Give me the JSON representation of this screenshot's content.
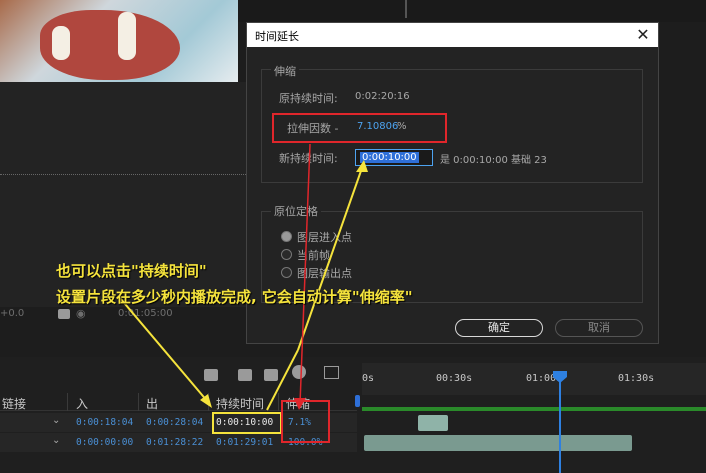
{
  "dialog": {
    "title": "时间延长",
    "close_glyph": "✕",
    "stretch_group": {
      "legend": "伸缩",
      "original_duration_label": "原持续时间:",
      "original_duration_value": "0:02:20:16",
      "stretch_factor_label": "拉伸因数 -",
      "stretch_factor_value": "7.10806",
      "stretch_factor_unit": "%",
      "new_duration_label": "新持续时间:",
      "new_duration_value": "0:00:10:00",
      "is_text": "是 0:00:10:00 基础 23"
    },
    "hold_group": {
      "legend": "原位定格",
      "options": [
        "图层进入点",
        "当前帧",
        "图层输出点"
      ],
      "selected_index": 0
    },
    "ok_label": "确定",
    "cancel_label": "取消"
  },
  "annotation": {
    "line1": "也可以点击\"持续时间\"",
    "line2": "设置片段在多少秒内播放完成, 它会自动计算\"伸缩率\""
  },
  "status": {
    "offset": "+0.0",
    "time": "0:01:05:00"
  },
  "timeline": {
    "columns": {
      "link": "链接",
      "in": "入",
      "out": "出",
      "duration": "持续时间",
      "stretch": "伸缩"
    },
    "rows": [
      {
        "in": "0:00:18:04",
        "out": "0:00:28:04",
        "duration": "0:00:10:00",
        "stretch": "7.1%"
      },
      {
        "in": "0:00:00:00",
        "out": "0:01:28:22",
        "duration": "0:01:29:01",
        "stretch": "100.0%"
      }
    ],
    "ruler_labels": [
      "0s",
      "00:30s",
      "01:00s",
      "01:30s"
    ]
  },
  "colors": {
    "accent_blue": "#4da3f0",
    "annotation_yellow": "#f5e33c",
    "highlight_red": "#e0262b"
  }
}
